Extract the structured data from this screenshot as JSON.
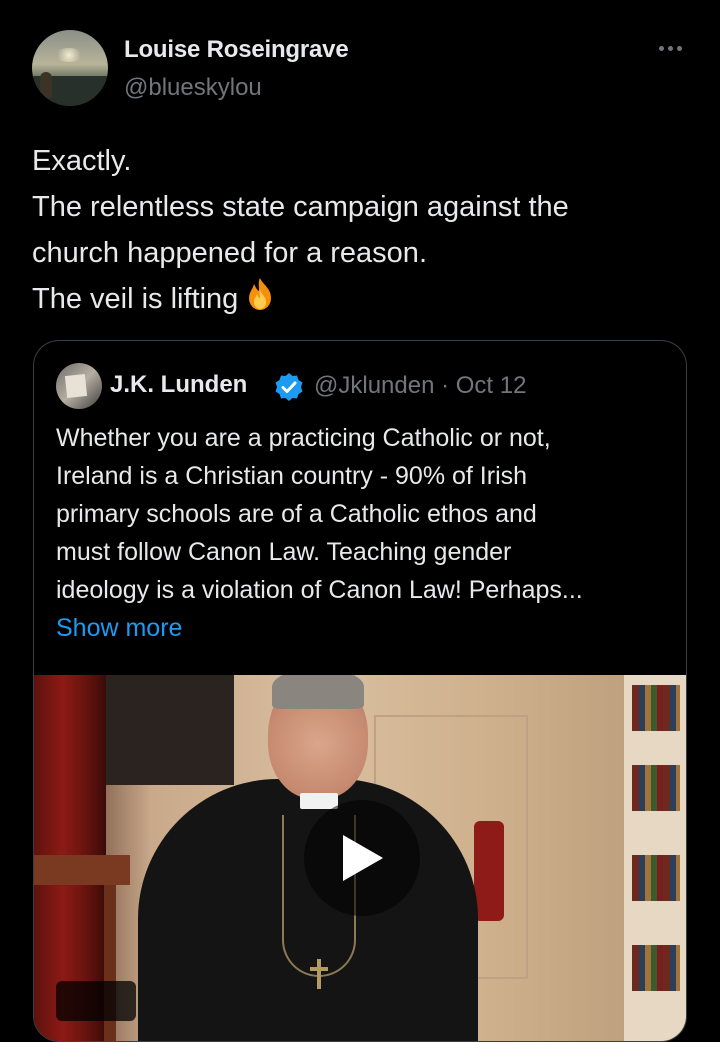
{
  "author": {
    "name": "Louise Roseingrave",
    "handle": "@blueskylou"
  },
  "tweet": {
    "lines": [
      "Exactly.",
      "The relentless state campaign against the",
      "church happened for a reason.",
      "The veil is lifting"
    ],
    "emoji": "fire-icon"
  },
  "quote": {
    "name": "J.K. Lunden",
    "handle_date": "@Jklunden · Oct 12",
    "lines": [
      "Whether you are a practicing Catholic or not,",
      "Ireland is a Christian country - 90% of Irish",
      "primary schools are of a Catholic ethos and",
      "must follow Canon Law.  Teaching gender",
      "ideology is a violation of Canon Law!  Perhaps..."
    ],
    "show_more": "Show more",
    "media": {
      "type": "video",
      "icon": "play-icon"
    }
  },
  "colors": {
    "background": "#000000",
    "text": "#e7e9ea",
    "secondary": "#71767b",
    "link": "#1d9bf0",
    "verified": "#1d9bf0"
  }
}
